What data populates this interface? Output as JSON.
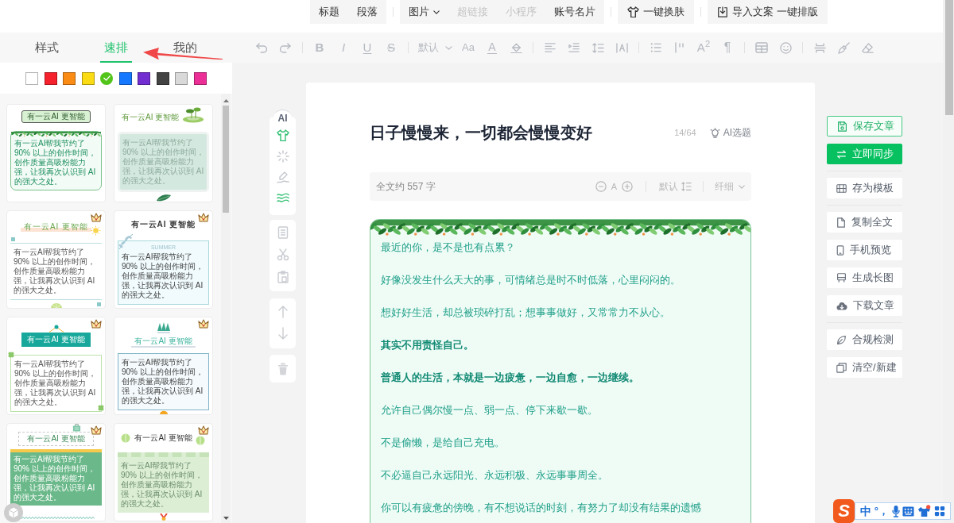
{
  "top_toolbar": [
    {
      "items": [
        {
          "label": "标题",
          "kind": "text",
          "disabled": false
        },
        {
          "label": "段落",
          "kind": "text",
          "disabled": false
        }
      ]
    },
    {
      "items": [
        {
          "label": "图片",
          "kind": "dropdown",
          "disabled": false
        },
        {
          "label": "超链接",
          "kind": "text",
          "disabled": true
        },
        {
          "label": "小程序",
          "kind": "text",
          "disabled": true
        },
        {
          "label": "账号名片",
          "kind": "text",
          "disabled": false
        }
      ]
    },
    {
      "items": [
        {
          "label": "一键换肤",
          "kind": "skin",
          "disabled": false
        }
      ]
    },
    {
      "items": [
        {
          "label": "导入文案 一键排版",
          "kind": "import",
          "disabled": false
        }
      ]
    }
  ],
  "side_tabs": [
    {
      "label": "样式",
      "selected": false
    },
    {
      "label": "速排",
      "selected": true
    },
    {
      "label": "我的",
      "selected": false
    }
  ],
  "format_toolbar": {
    "marks": [
      {
        "label": "B",
        "kind": "bold"
      },
      {
        "label": "I",
        "kind": "italic"
      },
      {
        "label": "U",
        "kind": "underline"
      },
      {
        "label": "S",
        "kind": "strike"
      }
    ],
    "font_size": "默认",
    "case": "Aa",
    "font_color": "A",
    "superscript": "A$^{2}$",
    "paragraph": "¶"
  },
  "color_swatches": [
    {
      "color": "#ffffff",
      "selected": false
    },
    {
      "color": "#f5222d",
      "selected": false
    },
    {
      "color": "#fa8c16",
      "selected": false
    },
    {
      "color": "#fadb14",
      "selected": false
    },
    {
      "color": "#52c41a",
      "selected": true
    },
    {
      "color": "#1677ff",
      "selected": false
    },
    {
      "color": "#722ed1",
      "selected": false
    },
    {
      "color": "#434343",
      "selected": false
    },
    {
      "color": "#d9d9d9",
      "selected": false
    },
    {
      "color": "#eb2f96",
      "selected": false
    }
  ],
  "templates": [
    {
      "kind": "garland",
      "title": "有一云AI 更智能",
      "text": "有一云AI帮我节约了 90% 以上的创作时间，创作质量高吸粉能力强，让我再次认识到 AI 的强大之处。",
      "vip": false
    },
    {
      "kind": "lotus",
      "title": "有一云AI 更智能",
      "text": "有一云AI帮我节约了 90% 以上的创作时间，创作质量高吸粉能力强，让我再次认识到 AI 的强大之处。",
      "vip": false
    },
    {
      "kind": "lime",
      "title": "有一云AI 更智能",
      "text": "有一云AI帮我节约了 90% 以上的创作时间，创作质量高吸粉能力强，让我再次认识到 AI 的强大之处。",
      "vip": true
    },
    {
      "kind": "summer",
      "title": "有一云AI 更智能",
      "tag": "SUMMER",
      "text": "有一云AI帮我节约了 90% 以上的创作时间，创作质量高吸粉能力强，让我再次认识到 AI 的强大之处。",
      "vip": true
    },
    {
      "kind": "banner",
      "title": "有一云AI 更智能",
      "text": "有一云AI帮我节约了 90% 以上的创作时间，创作质量高吸粉能力强，让我再次认识到 AI 的强大之处。",
      "vip": true
    },
    {
      "kind": "grid",
      "title": "有一云AI 更智能",
      "text": "有一云AI帮我节约了 90% 以上的创作时间，创作质量高吸粉能力强，让我再次认识到 AI 的强大之处。",
      "vip": true
    },
    {
      "kind": "clip",
      "title": "有一云AI 更智能",
      "text": "有一云AI帮我节约了 90% 以上的创作时间，创作质量高吸粉能力强，让我再次认识到 AI 的强大之处。",
      "vip": true
    },
    {
      "kind": "stripe",
      "title": "有一云AI 更智能",
      "text": "有一云AI帮我节约了 90% 以上的创作时间，创作质量高吸粉能力强，让我再次认识到 AI 的强大之处。",
      "vip": true
    }
  ],
  "tool_rail": {
    "ai_badge": "AI"
  },
  "editor": {
    "title": "日子慢慢来，一切都会慢慢变好",
    "title_count": "14/64",
    "ai_topic": "AI选题",
    "word_count": "全文约 557 字",
    "font_size_label": "A",
    "line_height": "默认",
    "font_weight": "纤细",
    "paragraphs": [
      {
        "text": "最近的你，是不是也有点累？",
        "bold": false
      },
      {
        "text": "好像没发生什么天大的事，可情绪总是时不时低落，心里闷闷的。",
        "bold": false
      },
      {
        "text": "想好好生活，却总被琐碎打乱；想事事做好，又常常力不从心。",
        "bold": false
      },
      {
        "text": "其实不用责怪自己。",
        "bold": true
      },
      {
        "text": "普通人的生活，本就是一边疲惫，一边自愈，一边继续。",
        "bold": true
      },
      {
        "text": "允许自己偶尔慢一点、弱一点、停下来歇一歇。",
        "bold": false
      },
      {
        "text": "不是偷懒，是给自己充电。",
        "bold": false
      },
      {
        "text": "不必逼自己永远阳光、永远积极、永远事事周全。",
        "bold": false
      },
      {
        "text": "你可以有疲惫的傍晚，有不想说话的时刻，有努力了却没有结果的遗憾",
        "bold": false
      }
    ]
  },
  "actions": [
    {
      "buttons": [
        {
          "label": "保存文章",
          "kind": "outline"
        },
        {
          "label": "立即同步",
          "kind": "primary"
        }
      ]
    },
    {
      "buttons": [
        {
          "label": "存为模板",
          "kind": "plain"
        }
      ]
    },
    {
      "buttons": [
        {
          "label": "复制全文",
          "kind": "plain"
        },
        {
          "label": "手机预览",
          "kind": "plain"
        },
        {
          "label": "生成长图",
          "kind": "plain"
        },
        {
          "label": "下载文章",
          "kind": "plain"
        }
      ]
    },
    {
      "buttons": [
        {
          "label": "合规检测",
          "kind": "plain"
        },
        {
          "label": "清空/新建",
          "kind": "plain"
        }
      ]
    }
  ],
  "ime_bar": {
    "logo": "S",
    "mode": "中",
    "punctuation": "°，"
  }
}
